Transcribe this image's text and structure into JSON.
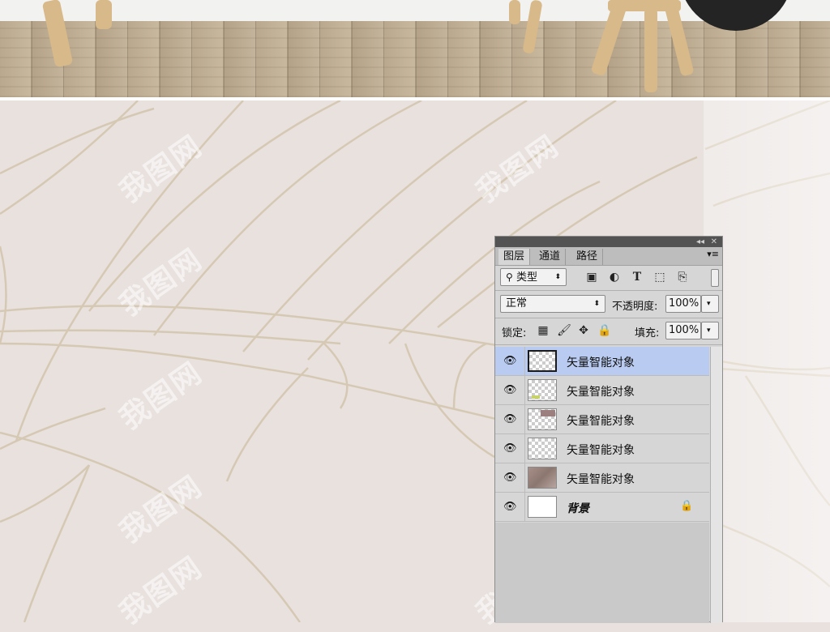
{
  "watermark": "我图网",
  "layers_panel": {
    "tabs": [
      "图层",
      "通道",
      "路径"
    ],
    "active_tab": "图层",
    "filter": {
      "label": "类型"
    },
    "blend_mode": "正常",
    "opacity": {
      "label": "不透明度:",
      "value": "100%"
    },
    "lock": {
      "label": "锁定:"
    },
    "fill": {
      "label": "填充:",
      "value": "100%"
    },
    "layers": [
      {
        "name": "矢量智能对象",
        "selected": true,
        "visible": true
      },
      {
        "name": "矢量智能对象",
        "selected": false,
        "visible": true
      },
      {
        "name": "矢量智能对象",
        "selected": false,
        "visible": true
      },
      {
        "name": "矢量智能对象",
        "selected": false,
        "visible": true
      },
      {
        "name": "矢量智能对象",
        "selected": false,
        "visible": true
      },
      {
        "name": "背景",
        "selected": false,
        "visible": true,
        "locked": true
      }
    ],
    "icons": [
      "collapse-icon",
      "close-icon",
      "panel-menu-icon",
      "search-icon",
      "image-filter-icon",
      "adjustment-filter-icon",
      "type-filter-icon",
      "shape-filter-icon",
      "smart-object-filter-icon",
      "lock-transparent-icon",
      "lock-brush-icon",
      "lock-move-icon",
      "lock-all-icon",
      "eye-icon",
      "lock-icon"
    ]
  },
  "colors": {
    "wallpaper": "#e8e1de",
    "leaf_line": "#d6c9b4",
    "panel_bg": "#d6d6d6",
    "selection": "#b9cbf0"
  }
}
